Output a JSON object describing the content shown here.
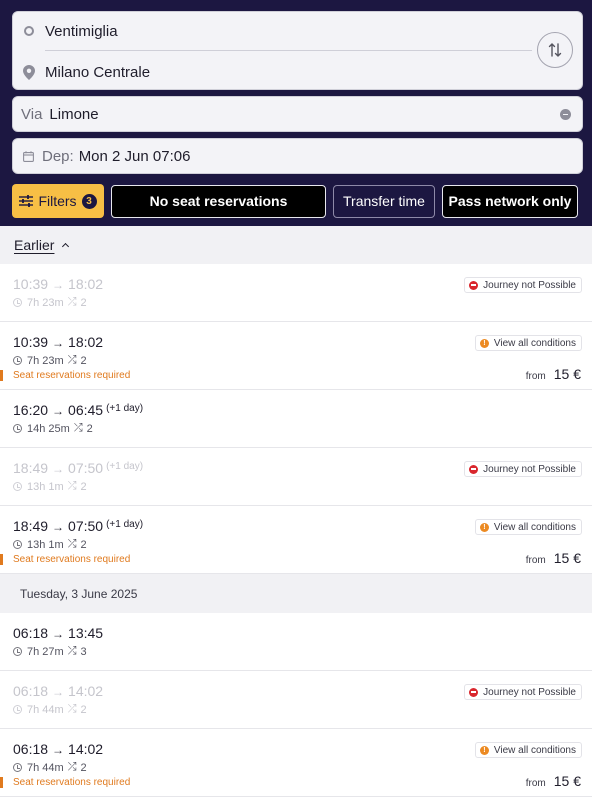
{
  "search": {
    "origin": "Ventimiglia",
    "destination": "Milano Centrale",
    "via_label": "Via",
    "via_value": "Limone",
    "dep_label": "Dep:",
    "dep_value": "Mon 2 Jun 07:06"
  },
  "filters": {
    "button_label": "Filters",
    "count": "3",
    "chips": [
      {
        "label": "No seat reservations",
        "active": true
      },
      {
        "label": "Transfer time",
        "active": false
      },
      {
        "label": "Pass network only",
        "active": true
      }
    ]
  },
  "earlier_label": "Earlier",
  "day_header": "Tuesday, 3 June 2025",
  "connections": [
    {
      "dep": "10:39",
      "arr": "18:02",
      "plus_day": "",
      "duration": "7h 23m",
      "changes": "2",
      "disabled": true,
      "badge": "Journey not Possible",
      "badge_type": "no",
      "seat_note": "",
      "price_from": "",
      "price": ""
    },
    {
      "dep": "10:39",
      "arr": "18:02",
      "plus_day": "",
      "duration": "7h 23m",
      "changes": "2",
      "disabled": false,
      "badge": "View all conditions",
      "badge_type": "info",
      "seat_note": "Seat reservations required",
      "price_from": "from",
      "price": "15 €"
    },
    {
      "dep": "16:20",
      "arr": "06:45",
      "plus_day": "(+1 day)",
      "duration": "14h 25m",
      "changes": "2",
      "disabled": false,
      "badge": "",
      "badge_type": "",
      "seat_note": "",
      "price_from": "",
      "price": ""
    },
    {
      "dep": "18:49",
      "arr": "07:50",
      "plus_day": "(+1 day)",
      "duration": "13h 1m",
      "changes": "2",
      "disabled": true,
      "badge": "Journey not Possible",
      "badge_type": "no",
      "seat_note": "",
      "price_from": "",
      "price": ""
    },
    {
      "dep": "18:49",
      "arr": "07:50",
      "plus_day": "(+1 day)",
      "duration": "13h 1m",
      "changes": "2",
      "disabled": false,
      "badge": "View all conditions",
      "badge_type": "info",
      "seat_note": "Seat reservations required",
      "price_from": "from",
      "price": "15 €"
    },
    {
      "dep": "06:18",
      "arr": "13:45",
      "plus_day": "",
      "duration": "7h 27m",
      "changes": "3",
      "disabled": false,
      "badge": "",
      "badge_type": "",
      "seat_note": "",
      "price_from": "",
      "price": ""
    },
    {
      "dep": "06:18",
      "arr": "14:02",
      "plus_day": "",
      "duration": "7h 44m",
      "changes": "2",
      "disabled": true,
      "badge": "Journey not Possible",
      "badge_type": "no",
      "seat_note": "",
      "price_from": "",
      "price": ""
    },
    {
      "dep": "06:18",
      "arr": "14:02",
      "plus_day": "",
      "duration": "7h 44m",
      "changes": "2",
      "disabled": false,
      "badge": "View all conditions",
      "badge_type": "info",
      "seat_note": "Seat reservations required",
      "price_from": "from",
      "price": "15 €"
    }
  ],
  "colors": {
    "header_bg": "#1c1741",
    "filters_accent": "#f7bf45",
    "seat_warning": "#e07a1e",
    "not_possible": "#d9262d",
    "conditions_info": "#ec8a22"
  }
}
